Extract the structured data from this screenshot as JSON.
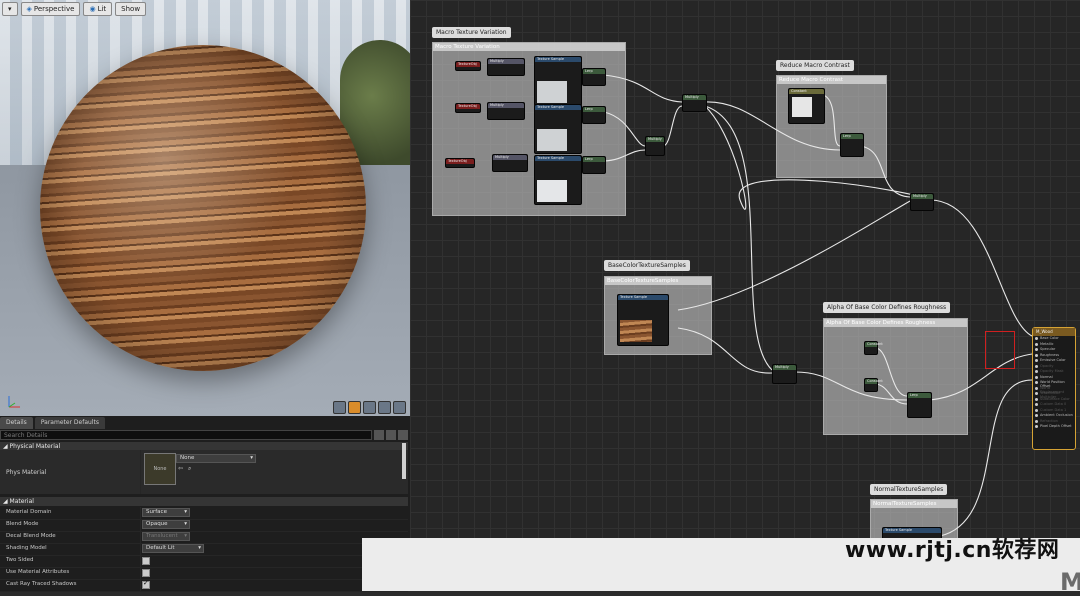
{
  "viewport": {
    "perspective_label": "Perspective",
    "lit_label": "Lit",
    "show_label": "Show"
  },
  "details_panel": {
    "tabs": [
      "Details",
      "Parameter Defaults"
    ],
    "search_placeholder": "Search Details",
    "physical_material": {
      "category": "Physical Material",
      "label": "Phys Material",
      "thumb_text": "None",
      "value": "None"
    },
    "material": {
      "category": "Material",
      "rows": [
        {
          "label": "Material Domain",
          "value": "Surface"
        },
        {
          "label": "Blend Mode",
          "value": "Opaque"
        },
        {
          "label": "Decal Blend Mode",
          "value": "Translucent"
        },
        {
          "label": "Shading Model",
          "value": "Default Lit"
        },
        {
          "label": "Two Sided",
          "checked": false
        },
        {
          "label": "Use Material Attributes",
          "checked": false
        },
        {
          "label": "Cast Ray Traced Shadows",
          "checked": true
        }
      ]
    }
  },
  "graph": {
    "comments": {
      "macro_texture_variation": {
        "title": "Macro Texture Variation",
        "header": "Macro Texture Variation"
      },
      "reduce_macro_contrast": {
        "title": "Reduce Macro Contrast",
        "header": "Reduce Macro Contrast"
      },
      "base_color_texture_samples": {
        "title": "BaseColorTextureSamples",
        "header": "BaseColorTextureSamples"
      },
      "alpha_roughness": {
        "title": "Alpha Of Base Color Defines Roughness",
        "header": "Alpha Of Base Color Defines Roughness"
      },
      "normal_texture_samples": {
        "title": "NormalTextureSamples",
        "header": "NormalTextureSamples"
      }
    },
    "nodes": {
      "texture_sample": "Texture Sample",
      "multiply": "Multiply",
      "lerp": "Lerp",
      "constant": "Constant",
      "param": "TextureObj"
    },
    "result_node": {
      "title": "M_Wood",
      "pins": [
        "Base Color",
        "Metallic",
        "Specular",
        "Roughness",
        "Emissive Color",
        "Opacity",
        "Opacity Mask",
        "Normal",
        "World Position Offset",
        "World Displacement",
        "Tessellation Multiplier",
        "Subsurface Color",
        "Custom Data 0",
        "Custom Data 1",
        "Ambient Occlusion",
        "Refraction",
        "Pixel Depth Offset"
      ]
    }
  },
  "watermark": {
    "text": "www.rjtj.cn软荐网",
    "corner": "M"
  },
  "colors": {
    "result_border": "#d6a334",
    "highlight_box": "#d02020",
    "normal_swatch": "#1010ff"
  }
}
